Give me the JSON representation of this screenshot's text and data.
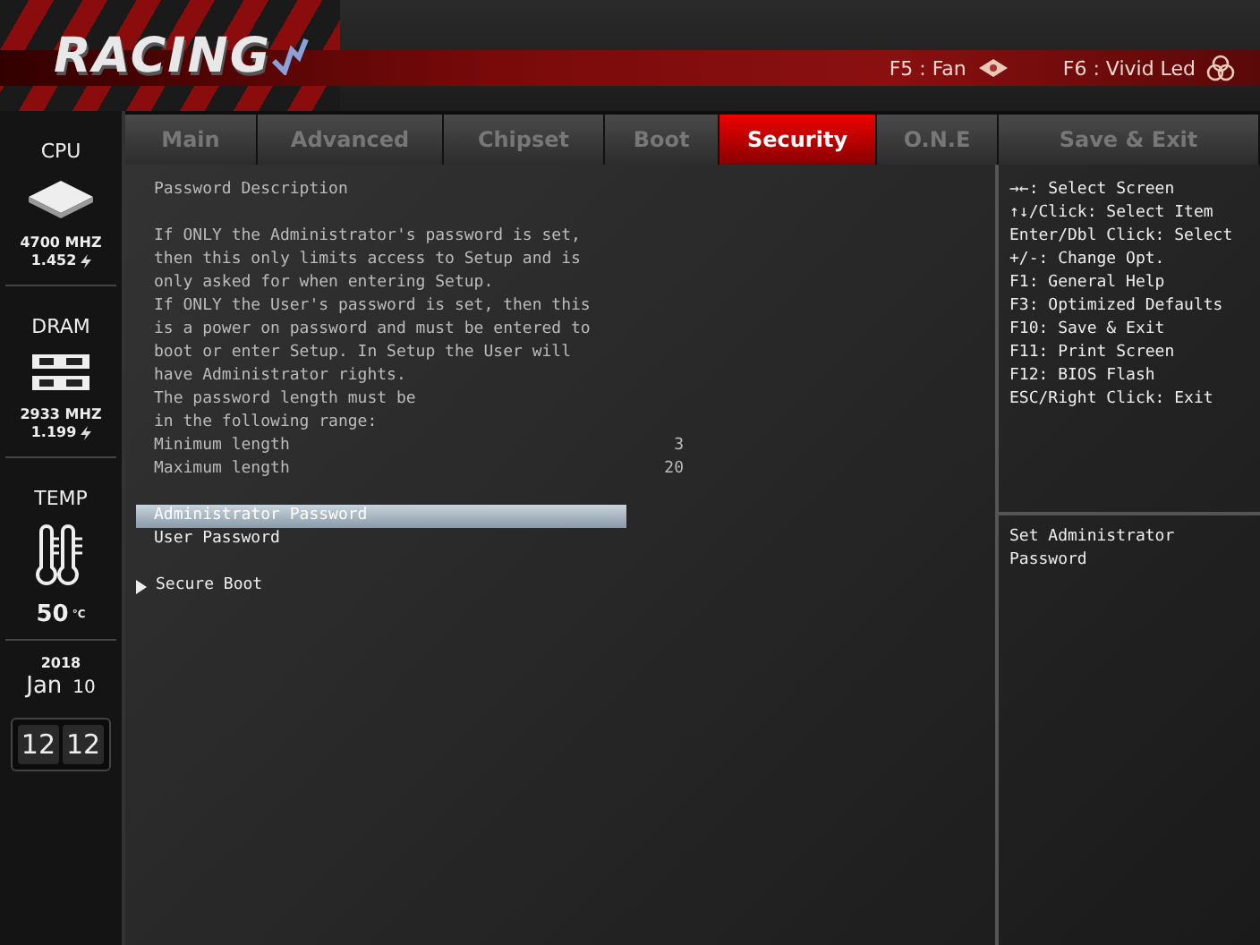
{
  "header": {
    "logo": "RACING",
    "hotkeys": [
      {
        "kind": "fan",
        "label": "F5 : Fan"
      },
      {
        "kind": "led",
        "label": "F6 : Vivid Led"
      }
    ]
  },
  "tabs": [
    {
      "label": "Main",
      "selected": false
    },
    {
      "label": "Advanced",
      "selected": false
    },
    {
      "label": "Chipset",
      "selected": false
    },
    {
      "label": "Boot",
      "selected": false
    },
    {
      "label": "Security",
      "selected": true
    },
    {
      "label": "O.N.E",
      "selected": false
    },
    {
      "label": "Save & Exit",
      "selected": false
    }
  ],
  "sidebar": {
    "cpu": {
      "label": "CPU",
      "frequency": "4700 MHZ",
      "voltage": "1.452"
    },
    "dram": {
      "label": "DRAM",
      "frequency": "2933 MHZ",
      "voltage": "1.199"
    },
    "temp": {
      "label": "TEMP",
      "value": "50",
      "unit": "°C"
    },
    "date": {
      "year": "2018",
      "month": "Jan",
      "day": "10"
    },
    "clock": {
      "hours": "12",
      "minutes": "12"
    }
  },
  "description": {
    "title": "Password Description",
    "lines": [
      "If ONLY the Administrator's password is set,",
      "then this only limits access to Setup and is",
      "only asked for when entering Setup.",
      "If ONLY the User's password is set, then this",
      "is a power on password and must be entered to",
      "boot or enter Setup. In Setup the User will",
      "have Administrator rights.",
      "The password length must be",
      "in the following range:"
    ],
    "ranges": [
      {
        "label": "Minimum length",
        "value": "3"
      },
      {
        "label": "Maximum length",
        "value": "20"
      }
    ]
  },
  "items": [
    {
      "kind": "setting",
      "label": "Administrator Password",
      "selected": true
    },
    {
      "kind": "setting",
      "label": "User Password",
      "selected": false
    },
    {
      "kind": "submenu",
      "label": "Secure Boot",
      "selected": false
    }
  ],
  "help": {
    "keys": [
      "→←: Select Screen",
      "↑↓/Click: Select Item",
      "Enter/Dbl Click: Select",
      "+/-: Change Opt.",
      "F1: General Help",
      "F3: Optimized Defaults",
      "F10: Save & Exit",
      "F11: Print Screen",
      "F12: BIOS Flash",
      "ESC/Right Click: Exit"
    ],
    "item_help": "Set Administrator Password"
  }
}
